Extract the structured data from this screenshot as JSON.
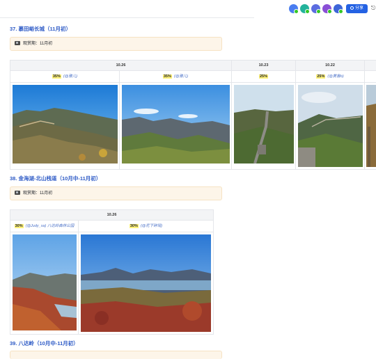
{
  "toolbar": {
    "share_label": "分享",
    "avatar_colors": [
      "#4a7df0",
      "#23b39b",
      "#5b6de0",
      "#8a4fd6",
      "#3d65d8"
    ]
  },
  "sections": [
    {
      "title": "37. 慕田峪长城（11月初）",
      "callout": "观赏期：11月初",
      "headers": [
        "10.26",
        "10.23",
        "10.22"
      ],
      "cells": [
        {
          "pct": "35%",
          "who": "(@雅儿)"
        },
        {
          "pct": "35%",
          "who": "(@雅儿)"
        },
        {
          "pct": "25%",
          "who": ""
        },
        {
          "pct": "25%",
          "who": "(@黄鲁b)"
        }
      ]
    },
    {
      "title": "38. 金海湖-北山栈道（10月中-11月初）",
      "callout": "观赏期：11月初",
      "headers": [
        "10.26"
      ],
      "cells": [
        {
          "pct": "30%",
          "who": "(@Judy_sa) 八达岭森林公园"
        },
        {
          "pct": "30%",
          "who": "(@花下碎瑶)"
        }
      ]
    },
    {
      "title": "39. 八达岭（10月中-11月初）"
    }
  ],
  "colors": {
    "accent": "#2d5ac6",
    "button": "#2462e3",
    "highlight": "#fff27a",
    "callout_bg": "#fdf5e9"
  }
}
